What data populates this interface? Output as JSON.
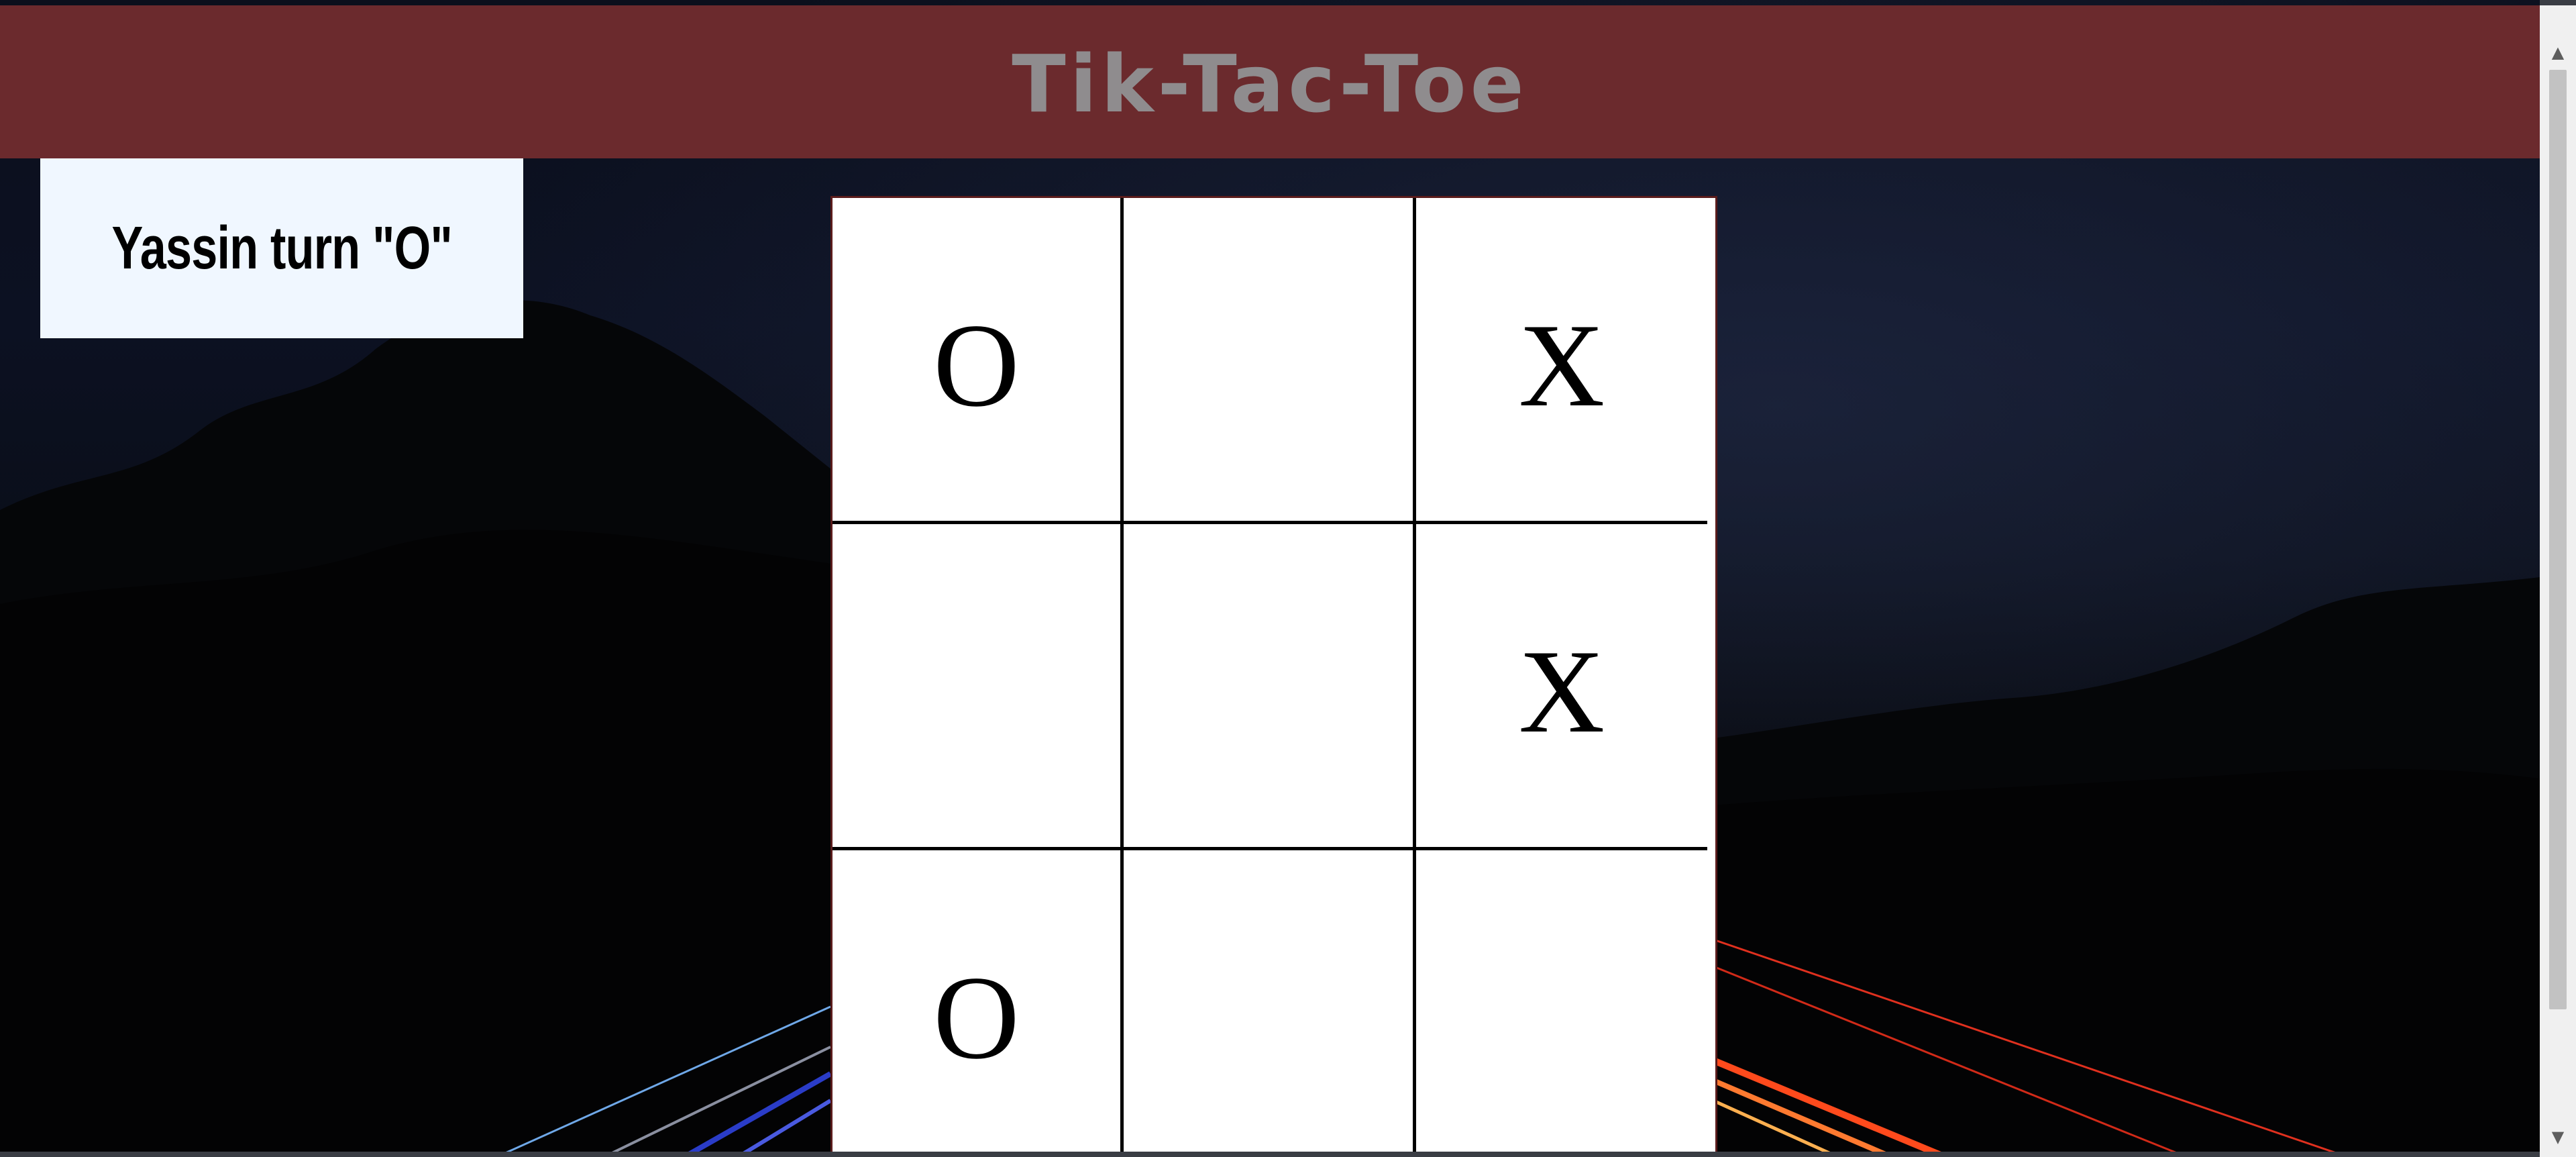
{
  "header": {
    "title": "Tik-Tac-Toe"
  },
  "status": {
    "turn_text": "Yassin turn \"O\""
  },
  "board": {
    "cells": [
      [
        "O",
        "",
        "X"
      ],
      [
        "",
        "",
        "X"
      ],
      [
        "O",
        "",
        ""
      ]
    ]
  },
  "colors": {
    "header_bg": "#6b2a2d",
    "header_text": "#8f8c8e",
    "turn_box_bg": "#f0f7ff",
    "board_bg": "#ffffff",
    "grid_line": "#000000"
  },
  "icons": {
    "scroll_up": "scroll-up-arrow-icon",
    "scroll_down": "scroll-down-arrow-icon"
  }
}
